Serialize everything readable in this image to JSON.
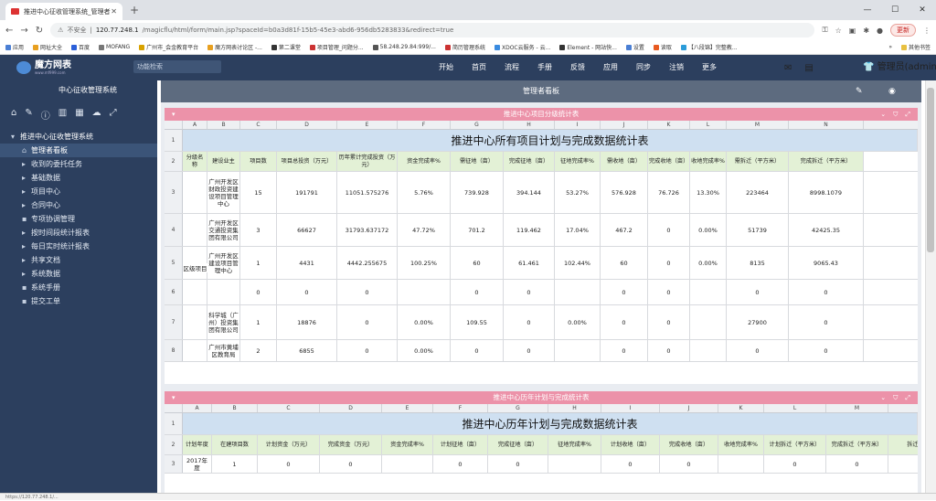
{
  "browser": {
    "tab_title": "推进中心征收管理系统_管理者驾驶",
    "url_warning": "不安全",
    "url_host": "120.77.248.1",
    "url_path": "/magicflu/html/form/main.jsp?spaceId=b0a3d81f-15b5-45e3-abd6-956db5283833&redirect=true",
    "update_label": "更新",
    "bookmarks": [
      "应用",
      "网址大全",
      "百度",
      "MOFANG",
      "广州市_会金教育平台",
      "魔方网表讨论区 -...",
      "第二课堂",
      "项目管理_问题分...",
      "58.248.29.84:999/...",
      "简历管理系统",
      "XDOC云服务 - 云...",
      "Element - 网站快...",
      "设置",
      "读取",
      "【八段锦】完整教..."
    ],
    "bookmark_more": "»",
    "bookmark_other": "其他书签"
  },
  "app": {
    "logo_name": "魔方网表",
    "logo_sub": "www.mf999.com",
    "search_placeholder": "功能检索",
    "nav": [
      "开始",
      "首页",
      "流程",
      "手册",
      "反馈",
      "应用",
      "同步",
      "注销",
      "更多"
    ],
    "user": "管理员(admin)"
  },
  "sidebar": {
    "system_title": "中心征收管理系统",
    "root": "推进中心征收管理系统",
    "items": [
      {
        "label": "管理者看板",
        "icon": "home-icon",
        "active": true,
        "twisty": ""
      },
      {
        "label": "收到的委托任务",
        "twisty": "▸"
      },
      {
        "label": "基础数据",
        "twisty": "▸"
      },
      {
        "label": "项目中心",
        "twisty": "▸"
      },
      {
        "label": "合同中心",
        "twisty": "▸"
      },
      {
        "label": "专项协调管理",
        "twisty": "▪"
      },
      {
        "label": "按时间段统计报表",
        "twisty": "▸"
      },
      {
        "label": "每日实时统计报表",
        "twisty": "▸"
      },
      {
        "label": "共享文档",
        "twisty": "▸"
      },
      {
        "label": "系统数据",
        "twisty": "▸"
      },
      {
        "label": "系统手册",
        "twisty": "▪"
      },
      {
        "label": "提交工单",
        "twisty": "▪"
      }
    ]
  },
  "content": {
    "bar_title": "管理者看板",
    "panel1": {
      "title": "推进中心项目分级统计表",
      "cols": [
        "A",
        "B",
        "C",
        "D",
        "E",
        "F",
        "G",
        "H",
        "I",
        "J",
        "K",
        "L",
        "M",
        "N"
      ],
      "big_title": "推进中心所有项目计划与完成数据统计表",
      "headers": [
        "分级名称",
        "建设业主",
        "项目数",
        "项目总投资（万元）",
        "历年累计完成投资（万元）",
        "资金完成率%",
        "需征地（亩）",
        "完成征地（亩）",
        "征地完成率%",
        "需收地（亩）",
        "完成收地（亩）",
        "收地完成率%",
        "需拆迁（平方米）",
        "完成拆迁（平方米）"
      ],
      "group_label": "区级项目",
      "rows": [
        {
          "n": "3",
          "cells": [
            "广州开发区财政投资建设项目管理中心",
            "15",
            "191791",
            "11051.575276",
            "5.76%",
            "739.928",
            "394.144",
            "53.27%",
            "576.928",
            "76.726",
            "13.30%",
            "223464",
            "8998.1079"
          ]
        },
        {
          "n": "4",
          "cells": [
            "广州开发区交通投资集团有限公司",
            "3",
            "66627",
            "31793.637172",
            "47.72%",
            "701.2",
            "119.462",
            "17.04%",
            "467.2",
            "0",
            "0.00%",
            "51739",
            "42425.35"
          ]
        },
        {
          "n": "5",
          "cells": [
            "广州开发区建设项目管理中心",
            "1",
            "4431",
            "4442.255675",
            "100.25%",
            "60",
            "61.461",
            "102.44%",
            "60",
            "0",
            "0.00%",
            "8135",
            "9065.43"
          ]
        },
        {
          "n": "6",
          "cells": [
            "",
            "0",
            "0",
            "0",
            "",
            "0",
            "0",
            "",
            "0",
            "0",
            "",
            "0",
            "0"
          ]
        },
        {
          "n": "7",
          "cells": [
            "科学城（广州）投资集团有限公司",
            "1",
            "18876",
            "0",
            "0.00%",
            "109.55",
            "0",
            "0.00%",
            "0",
            "0",
            "",
            "27900",
            "0"
          ]
        },
        {
          "n": "8",
          "cells": [
            "广州市黄埔区教育局",
            "2",
            "6855",
            "0",
            "0.00%",
            "0",
            "0",
            "",
            "0",
            "0",
            "",
            "0",
            "0"
          ]
        }
      ]
    },
    "panel2": {
      "title": "推进中心历年计划与完成统计表",
      "cols": [
        "A",
        "B",
        "C",
        "D",
        "E",
        "F",
        "G",
        "H",
        "I",
        "J",
        "K",
        "L",
        "M"
      ],
      "big_title": "推进中心历年计划与完成数据统计表",
      "headers": [
        "计划年度",
        "在建项目数",
        "计划资金（万元）",
        "完成资金（万元）",
        "资金完成率%",
        "计划征地（亩）",
        "完成征地（亩）",
        "征地完成率%",
        "计划收地（亩）",
        "完成收地（亩）",
        "收地完成率%",
        "计划拆迁（平方米）",
        "完成拆迁（平方米）",
        "拆迁"
      ],
      "rows": [
        {
          "n": "3",
          "cells": [
            "2017年度",
            "1",
            "0",
            "0",
            "",
            "0",
            "0",
            "",
            "0",
            "0",
            "",
            "0",
            "0",
            ""
          ]
        }
      ]
    }
  },
  "status": {
    "left": "https://120.77.248.1/..."
  },
  "colors": {
    "header_bg": "#2c3f5e",
    "panel_head": "#ec92a9",
    "title_bg": "#cfe0f1",
    "header_cell_bg": "#e3f1d6"
  }
}
